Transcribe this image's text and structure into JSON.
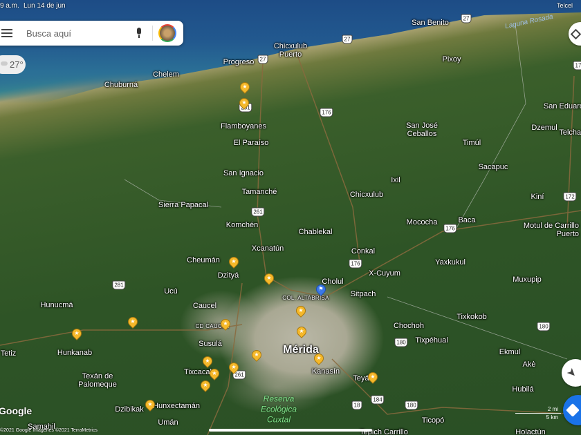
{
  "status_bar": {
    "time": "9 a.m.",
    "date": "Lun 14 de jun",
    "carrier": "Telcel"
  },
  "search": {
    "placeholder": "Busca aquí",
    "mic_icon": "microphone-icon",
    "avatar_icon": "account-avatar"
  },
  "weather": {
    "temp": "27°",
    "icon": "cloud-icon"
  },
  "places": [
    {
      "name": "Chelem"
    },
    {
      "name": "Chuburná"
    },
    {
      "name": "Progreso"
    },
    {
      "name": "Chicxulub Puerto"
    },
    {
      "name": "San Benito"
    },
    {
      "name": "Pixoy"
    },
    {
      "name": "Flamboyanes"
    },
    {
      "name": "El Paraíso"
    },
    {
      "name": "San Ignacio"
    },
    {
      "name": "Tamanché"
    },
    {
      "name": "Sierra Papacal"
    },
    {
      "name": "Komchén"
    },
    {
      "name": "Chablekal"
    },
    {
      "name": "Chicxulub"
    },
    {
      "name": "Ixil"
    },
    {
      "name": "San José Ceballos"
    },
    {
      "name": "Timúl"
    },
    {
      "name": "Sacapuc"
    },
    {
      "name": "Dzemul"
    },
    {
      "name": "San Eduardo"
    },
    {
      "name": "Telchac"
    },
    {
      "name": "Kiní"
    },
    {
      "name": "Motul de Carrillo Puerto"
    },
    {
      "name": "Mococha"
    },
    {
      "name": "Baca"
    },
    {
      "name": "Xcanatún"
    },
    {
      "name": "Conkal"
    },
    {
      "name": "Cheumán"
    },
    {
      "name": "Yaxkukul"
    },
    {
      "name": "Dzityá"
    },
    {
      "name": "X-Cuyum"
    },
    {
      "name": "Muxupip"
    },
    {
      "name": "Cholul"
    },
    {
      "name": "Ucú"
    },
    {
      "name": "COL. ALTABRISA"
    },
    {
      "name": "Sitpach"
    },
    {
      "name": "Hunucmá"
    },
    {
      "name": "Caucel"
    },
    {
      "name": "Chochoh"
    },
    {
      "name": "Tixkokob"
    },
    {
      "name": "CD CAUCEL"
    },
    {
      "name": "Tixpéhual"
    },
    {
      "name": "Susulá"
    },
    {
      "name": "Mérida"
    },
    {
      "name": "Hunkanab"
    },
    {
      "name": "Tetiz"
    },
    {
      "name": "Ekmul"
    },
    {
      "name": "Kanasín"
    },
    {
      "name": "Tixcacal"
    },
    {
      "name": "Teyá"
    },
    {
      "name": "Akė"
    },
    {
      "name": "Texán de Palomeque"
    },
    {
      "name": "Hubilá"
    },
    {
      "name": "Dzibikak"
    },
    {
      "name": "Hunxectamán"
    },
    {
      "name": "Umán"
    },
    {
      "name": "Samahil"
    },
    {
      "name": "Ticopó"
    },
    {
      "name": "Tepich Carrillo"
    },
    {
      "name": "Holactún"
    },
    {
      "name": "Laguna Rosada"
    },
    {
      "name": "Reserva Ecológica Cuxtal"
    }
  ],
  "road_shields": [
    "27",
    "27",
    "27",
    "261",
    "176",
    "261",
    "176",
    "176",
    "281",
    "180",
    "180",
    "261",
    "184",
    "18",
    "180",
    "172",
    "17"
  ],
  "pins": {
    "saved_count": 17,
    "flag_count": 1
  },
  "scale": {
    "miles": "2 mi",
    "km": "5 km"
  },
  "attribution": "©2021 Google Imágenes ©2021 TerraMetrics",
  "logo": "Google",
  "buttons": {
    "layers_icon": "layers-icon",
    "location_icon": "navigation-arrow-icon",
    "directions_icon": "directions-icon"
  },
  "colors": {
    "pin": "#f5b82a",
    "flag_pin": "#3b78e7",
    "directions": "#1a73e8"
  }
}
